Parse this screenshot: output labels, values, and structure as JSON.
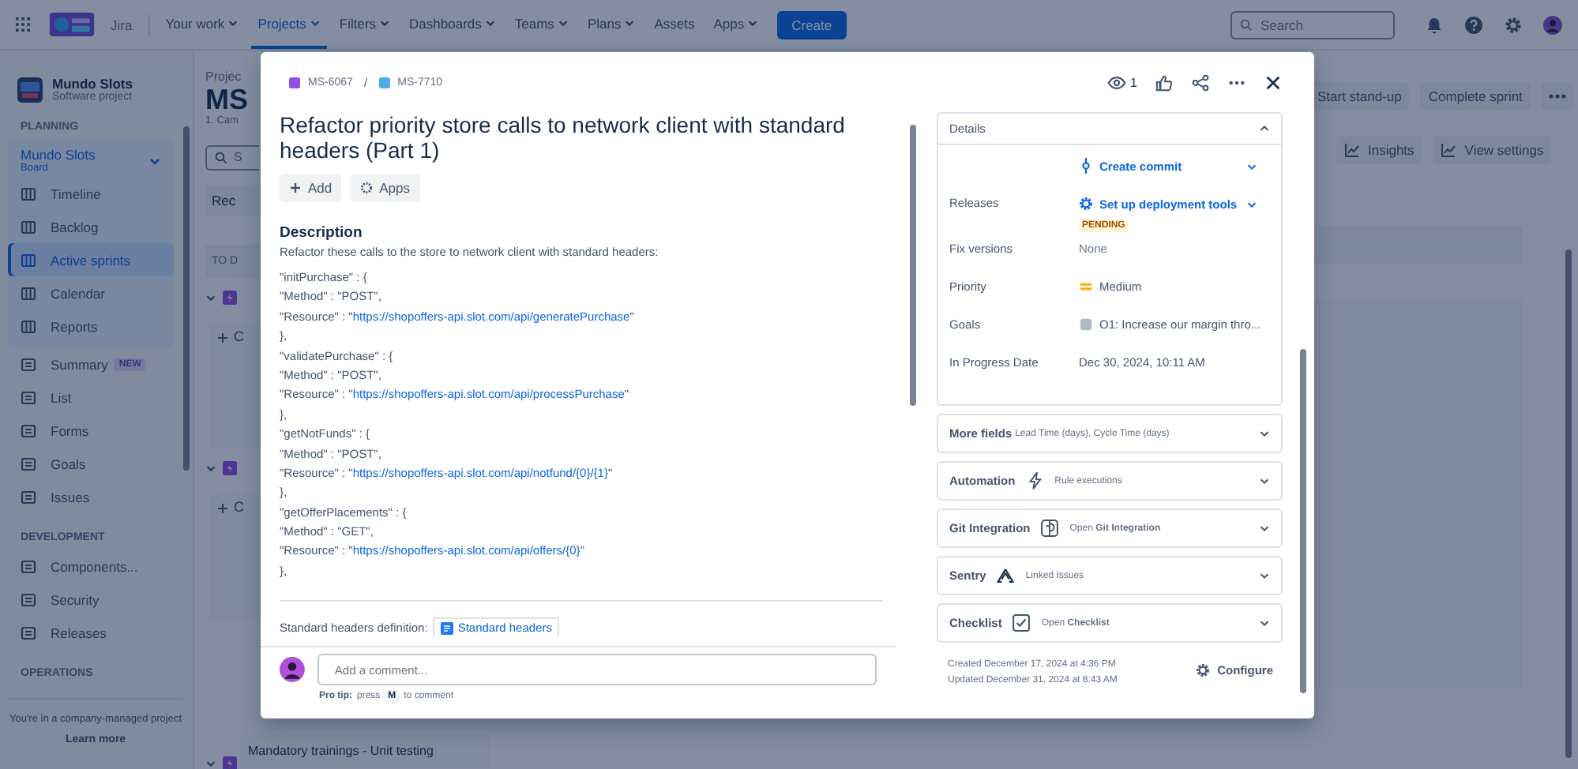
{
  "nav": {
    "product": "Jira",
    "items": [
      {
        "label": "Your work",
        "dropdown": true,
        "selected": false
      },
      {
        "label": "Projects",
        "dropdown": true,
        "selected": true
      },
      {
        "label": "Filters",
        "dropdown": true,
        "selected": false
      },
      {
        "label": "Dashboards",
        "dropdown": true,
        "selected": false
      },
      {
        "label": "Teams",
        "dropdown": true,
        "selected": false
      },
      {
        "label": "Plans",
        "dropdown": true,
        "selected": false
      },
      {
        "label": "Assets",
        "dropdown": false,
        "selected": false
      },
      {
        "label": "Apps",
        "dropdown": true,
        "selected": false
      }
    ],
    "create": "Create",
    "search": {
      "placeholder": "Search"
    }
  },
  "sidebar": {
    "project": {
      "name": "Mundo Slots",
      "type": "Software project"
    },
    "sections": [
      {
        "heading": "PLANNING",
        "board": {
          "name": "Mundo Slots",
          "type": "Board",
          "items": [
            {
              "label": "Timeline",
              "selected": false
            },
            {
              "label": "Backlog",
              "selected": false
            },
            {
              "label": "Active sprints",
              "selected": true
            },
            {
              "label": "Calendar",
              "selected": false
            },
            {
              "label": "Reports",
              "selected": false
            }
          ]
        },
        "items": [
          {
            "label": "Summary",
            "badge": "NEW"
          },
          {
            "label": "List"
          },
          {
            "label": "Forms"
          },
          {
            "label": "Goals"
          },
          {
            "label": "Issues"
          }
        ]
      },
      {
        "heading": "DEVELOPMENT",
        "items": [
          {
            "label": "Components..."
          },
          {
            "label": "Security"
          },
          {
            "label": "Releases"
          }
        ]
      },
      {
        "heading": "OPERATIONS"
      }
    ],
    "footer": {
      "text": "You're in a company-managed project",
      "link": "Learn more"
    }
  },
  "board": {
    "breadcrumb": "Projec",
    "title": "MS",
    "subtitle": "1. Cam",
    "search_placeholder": "S",
    "filter": "Rec",
    "column": "TO D",
    "create_labels": [
      "C",
      "C"
    ],
    "actions": [
      "Start stand-up",
      "Complete sprint"
    ],
    "tools": [
      "Insights",
      "View settings"
    ],
    "card": "Mandatory trainings - Unit testing"
  },
  "issue": {
    "separator": "/",
    "breadcrumbs": [
      {
        "key": "MS-6067",
        "color": "#904ee2"
      },
      {
        "key": "MS-7710",
        "color": "#4bade8"
      }
    ],
    "watchers": "1",
    "title": "Refactor priority store calls to network client with standard headers (Part 1)",
    "buttons": [
      "Add",
      "Apps"
    ],
    "description": {
      "heading": "Description",
      "intro": "Refactor these calls to the store to network client with standard headers:",
      "lines": [
        {
          "text": "\"initPurchase\" : {"
        },
        {
          "text": "\"Method\" : \"POST\","
        },
        {
          "text": "\"Resource\" : \"",
          "link": "https://shopoffers-api.slot.com/api/generatePurchase",
          "tail": "\""
        },
        {
          "text": "},"
        },
        {
          "text": "\"validatePurchase\" : {"
        },
        {
          "text": "\"Method\" : \"POST\","
        },
        {
          "text": "\"Resource\" : \"",
          "link": "https://shopoffers-api.slot.com/api/processPurchase",
          "tail": "\""
        },
        {
          "text": "},"
        },
        {
          "text": "\"getNotFunds\" : {"
        },
        {
          "text": "\"Method\" : \"POST\","
        },
        {
          "text": "\"Resource\" : \"",
          "link": "https://shopoffers-api.slot.com/api/notfund/{0}/{1}",
          "tail": "\""
        },
        {
          "text": "},"
        },
        {
          "text": "\"getOfferPlacements\" : {"
        },
        {
          "text": "\"Method\" : \"GET\","
        },
        {
          "text": "\"Resource\" : \"",
          "link": "https://shopoffers-api.slot.com/api/offers/{0}",
          "tail": "\""
        },
        {
          "text": "},"
        }
      ],
      "headers_label": "Standard headers definition:",
      "headers_link": "Standard headers"
    },
    "comment": {
      "placeholder": "Add a comment...",
      "tip_label": "Pro tip:",
      "tip_before": "press",
      "key": "M",
      "tip_after": "to comment"
    },
    "details": {
      "title": "Details",
      "expanded": true,
      "rows": [
        {
          "value": "Create commit",
          "kind": "link"
        },
        {
          "label": "Releases",
          "value": "Set up deployment tools",
          "kind": "link",
          "badge": "PENDING"
        },
        {
          "label": "Fix versions",
          "value": "None",
          "kind": "muted"
        },
        {
          "label": "Priority",
          "value": "Medium",
          "kind": "priority"
        },
        {
          "label": "Goals",
          "value": "O1: Increase our margin thro...",
          "kind": "goal"
        },
        {
          "label": "In Progress Date",
          "value": "Dec 30, 2024, 10:11 AM",
          "kind": "text"
        }
      ]
    },
    "panels": [
      {
        "title": "More fields",
        "detail": "Lead Time (days), Cycle Time (days)",
        "expanded": false
      },
      {
        "title": "Automation",
        "detail": "Rule executions",
        "expanded": false
      },
      {
        "title": "Git Integration",
        "detail": "Open **Git Integration**",
        "expanded": false
      },
      {
        "title": "Sentry",
        "detail": "Linked Issues",
        "expanded": false
      },
      {
        "title": "Checklist",
        "detail": "Open **Checklist**",
        "expanded": false
      }
    ],
    "created": "Created December 17, 2024 at 4:36 PM",
    "updated": "Updated December 31, 2024 at 8:43 AM",
    "configure": "Configure"
  }
}
